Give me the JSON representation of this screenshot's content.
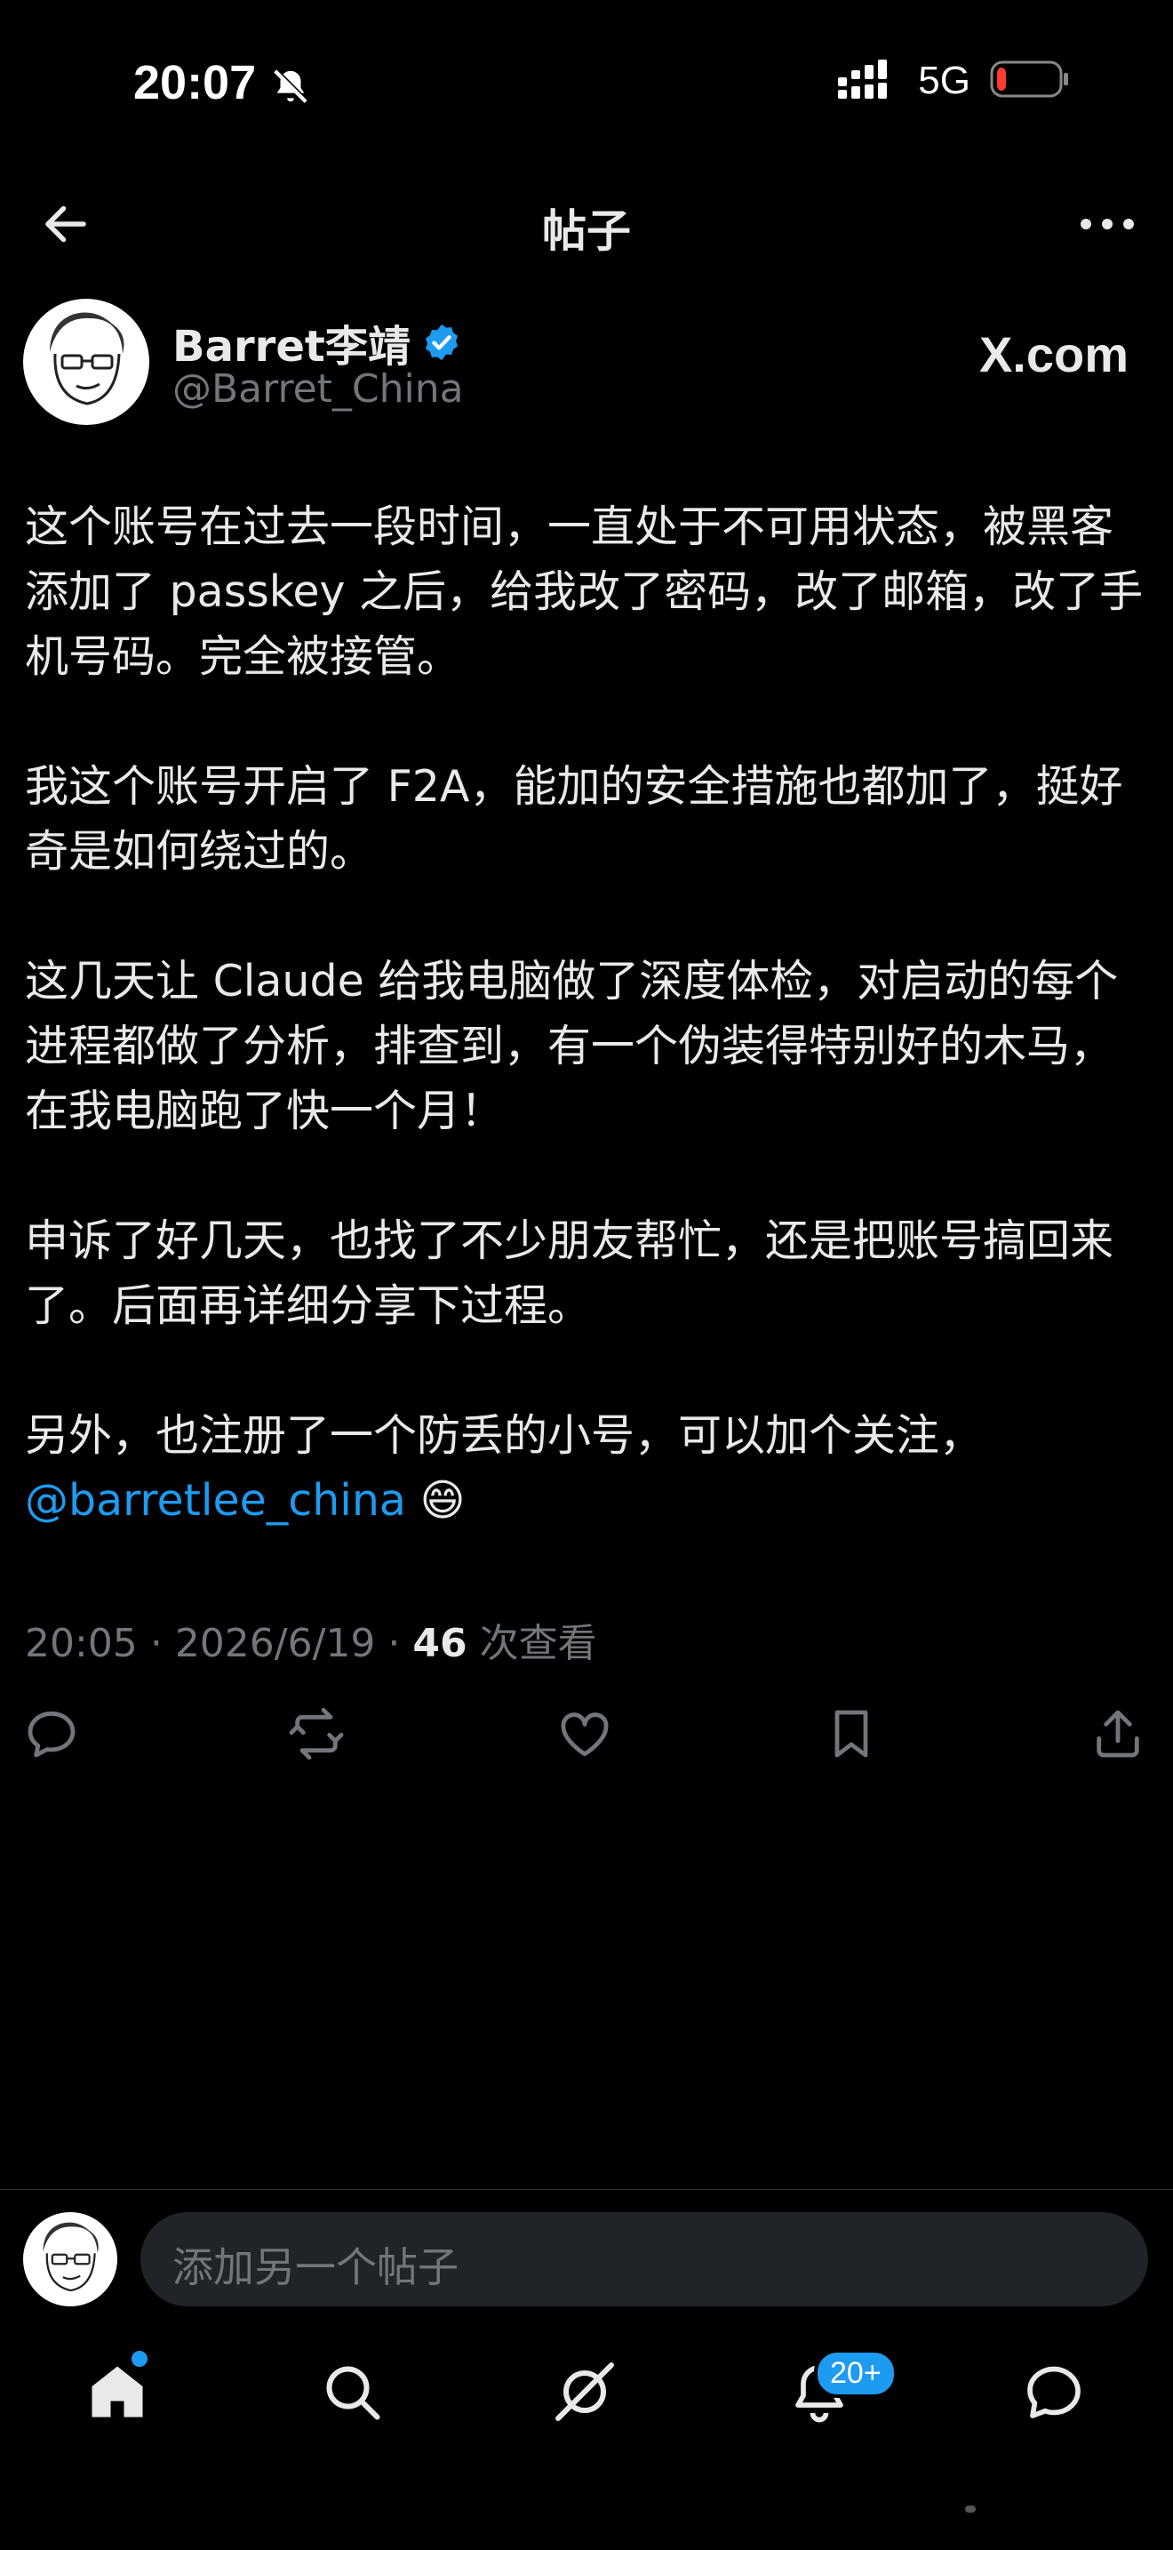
{
  "status_bar": {
    "time": "20:07",
    "network": "5G",
    "silent_icon": "bell-slash-icon",
    "battery_level": 0.15
  },
  "header": {
    "title": "帖子",
    "back_icon": "arrow-left-icon",
    "more_icon": "more-horizontal-icon"
  },
  "author": {
    "name": "Barret李靖",
    "handle": "@Barret_China",
    "verified": true,
    "source": "X.com"
  },
  "post": {
    "paragraphs": [
      "这个账号在过去一段时间，一直处于不可用状态，被黑客添加了 passkey 之后，给我改了密码，改了邮箱，改了手机号码。完全被接管。",
      "我这个账号开启了 F2A，能加的安全措施也都加了，挺好奇是如何绕过的。",
      "这几天让 Claude 给我电脑做了深度体检，对启动的每个进程都做了分析，排查到，有一个伪装得特别好的木马，在我电脑跑了快一个月！",
      "申诉了好几天，也找了不少朋友帮忙，还是把账号搞回来了。后面再详细分享下过程。",
      "另外，也注册了一个防丢的小号，可以加个关注，"
    ],
    "mention": "@barretlee_china",
    "emoji": "😄",
    "time": "20:05",
    "date": "2026/6/19",
    "views": "46",
    "views_label": "次查看",
    "separator": "·"
  },
  "actions": [
    "reply-icon",
    "repost-icon",
    "like-icon",
    "bookmark-icon",
    "share-icon"
  ],
  "compose": {
    "placeholder": "添加另一个帖子"
  },
  "tabbar": {
    "notification_badge": "20+"
  },
  "colors": {
    "accent": "#1d9bf0",
    "text": "#e7e9ea",
    "muted": "#71767b",
    "bg": "#000000"
  }
}
